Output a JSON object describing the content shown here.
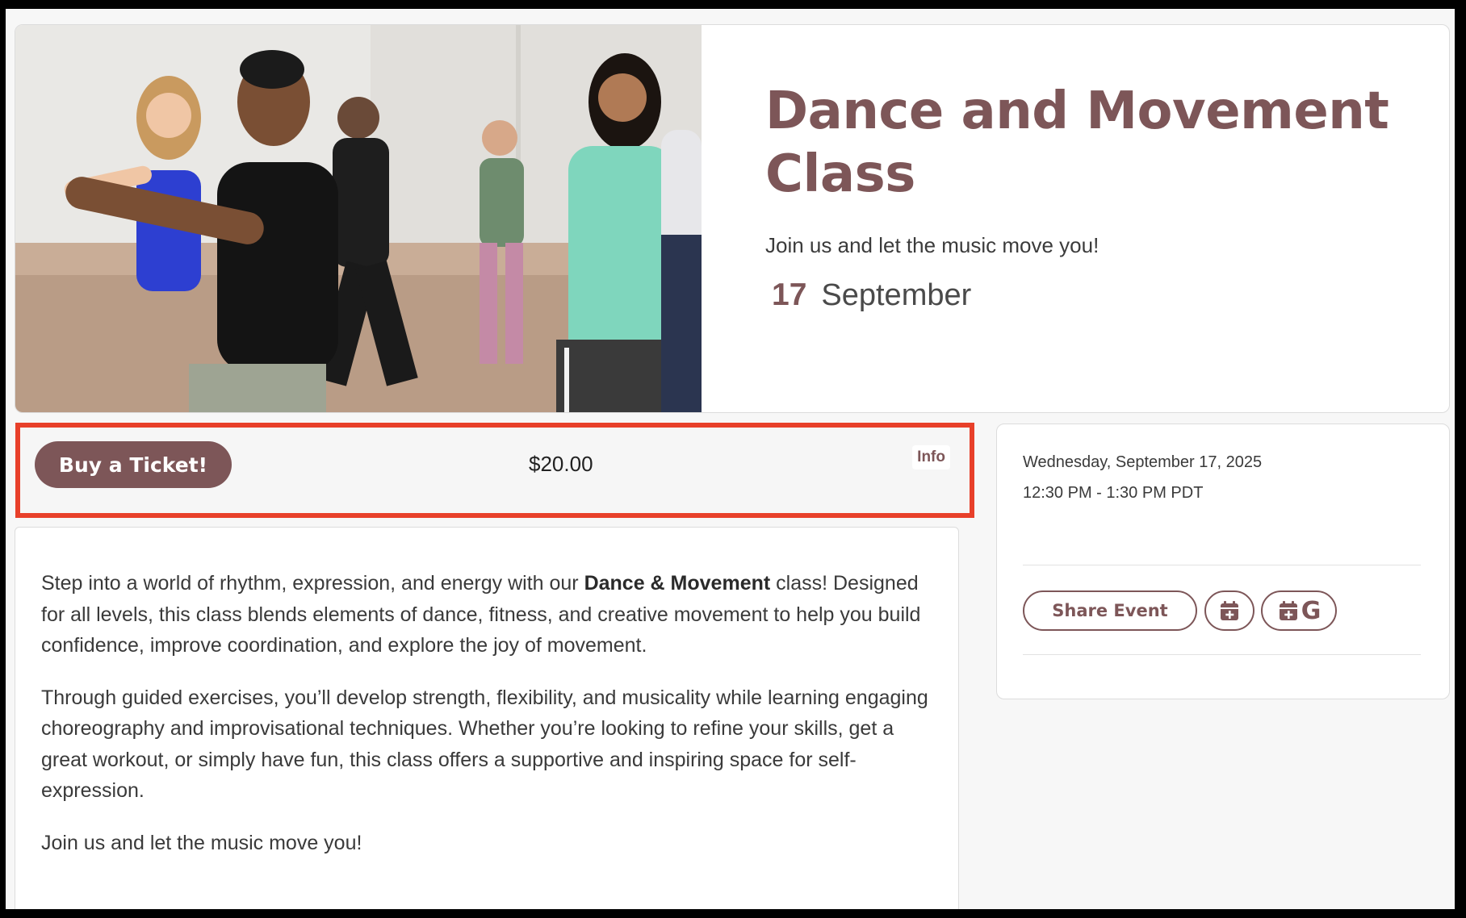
{
  "event": {
    "title": "Dance and Movement Class",
    "tagline": "Join us and let the music move you!",
    "day": "17",
    "month": "September"
  },
  "ticket": {
    "buy_label": "Buy a Ticket!",
    "price": "$20.00",
    "info_label": "Info"
  },
  "description": {
    "p1_before": "Step into a world of rhythm, expression, and energy with our ",
    "p1_bold": "Dance & Movement",
    "p1_after": " class! Designed for all levels, this class blends elements of dance, fitness, and creative movement to help you build confidence, improve coordination, and explore the joy of movement.",
    "p2": "Through guided exercises, you’ll develop strength, flexibility, and musicality while learning engaging choreography and improvisational techniques. Whether you’re looking to refine your skills, get a great workout, or simply have fun, this class offers a supportive and inspiring space for self-expression.",
    "p3": "Join us and let the music move you!"
  },
  "sidebar": {
    "date": "Wednesday, September 17, 2025",
    "time": "12:30 PM - 1:30 PM PDT",
    "share_label": "Share Event",
    "gcal_letter": "G",
    "icons": [
      "add-to-calendar-icon",
      "google-calendar-icon"
    ]
  },
  "colors": {
    "accent": "#7d5658",
    "highlight_border": "#e8402a"
  }
}
